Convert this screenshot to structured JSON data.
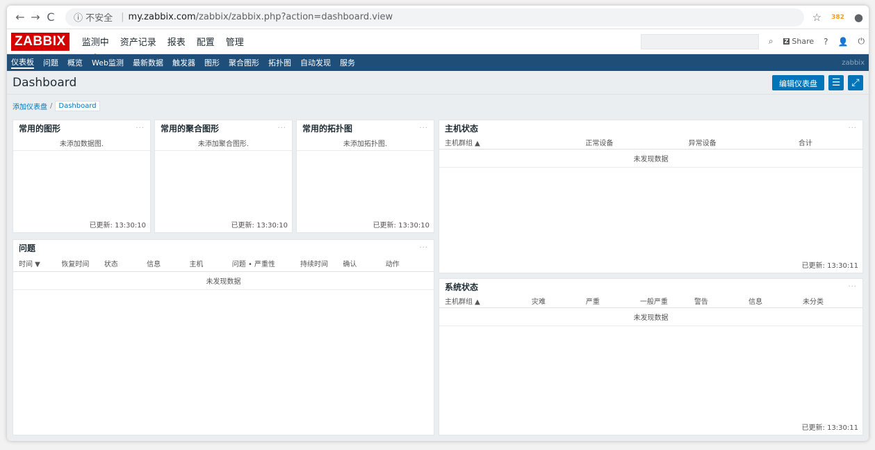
{
  "browser": {
    "back": "←",
    "forward": "→",
    "reload": "C",
    "insecure_label": "ⓘ 不安全",
    "url_host": "my.zabbix.com",
    "url_path": "/zabbix/zabbix.php?action=dashboard.view",
    "ext_badge": "382"
  },
  "header": {
    "logo": "ZABBIX",
    "menu": [
      "监测中",
      "资产记录",
      "报表",
      "配置",
      "管理"
    ],
    "share": "Share",
    "help": "?"
  },
  "subnav": {
    "items": [
      "仪表板",
      "问题",
      "概览",
      "Web监测",
      "最新数据",
      "触发器",
      "图形",
      "聚合图形",
      "拓扑图",
      "自动发现",
      "服务"
    ],
    "username": "zabbix"
  },
  "page": {
    "title": "Dashboard",
    "edit_button": "编辑仪表盘",
    "breadcrumb_root": "添加仪表盘",
    "breadcrumb_current": "Dashboard"
  },
  "widgets": {
    "fav_graphs": {
      "title": "常用的图形",
      "empty": "未添加数据图.",
      "updated": "已更新: 13:30:10"
    },
    "fav_screens": {
      "title": "常用的聚合图形",
      "empty": "未添加聚合图形.",
      "updated": "已更新: 13:30:10"
    },
    "fav_maps": {
      "title": "常用的拓扑图",
      "empty": "未添加拓扑图.",
      "updated": "已更新: 13:30:10"
    },
    "host_status": {
      "title": "主机状态",
      "columns": [
        "主机群组 ▲",
        "正常设备",
        "异常设备",
        "合计"
      ],
      "nodata": "未发现数据",
      "updated": "已更新: 13:30:11"
    },
    "problems": {
      "title": "问题",
      "columns": [
        "时间 ▼",
        "恢复时间",
        "状态",
        "信息",
        "主机",
        "问题 • 严重性",
        "持续时间",
        "确认",
        "动作"
      ],
      "nodata": "未发现数据"
    },
    "system_status": {
      "title": "系统状态",
      "columns": [
        "主机群组 ▲",
        "灾难",
        "严重",
        "一般严重",
        "警告",
        "信息",
        "未分类"
      ],
      "nodata": "未发现数据",
      "updated": "已更新: 13:30:11"
    },
    "dots": "···"
  }
}
